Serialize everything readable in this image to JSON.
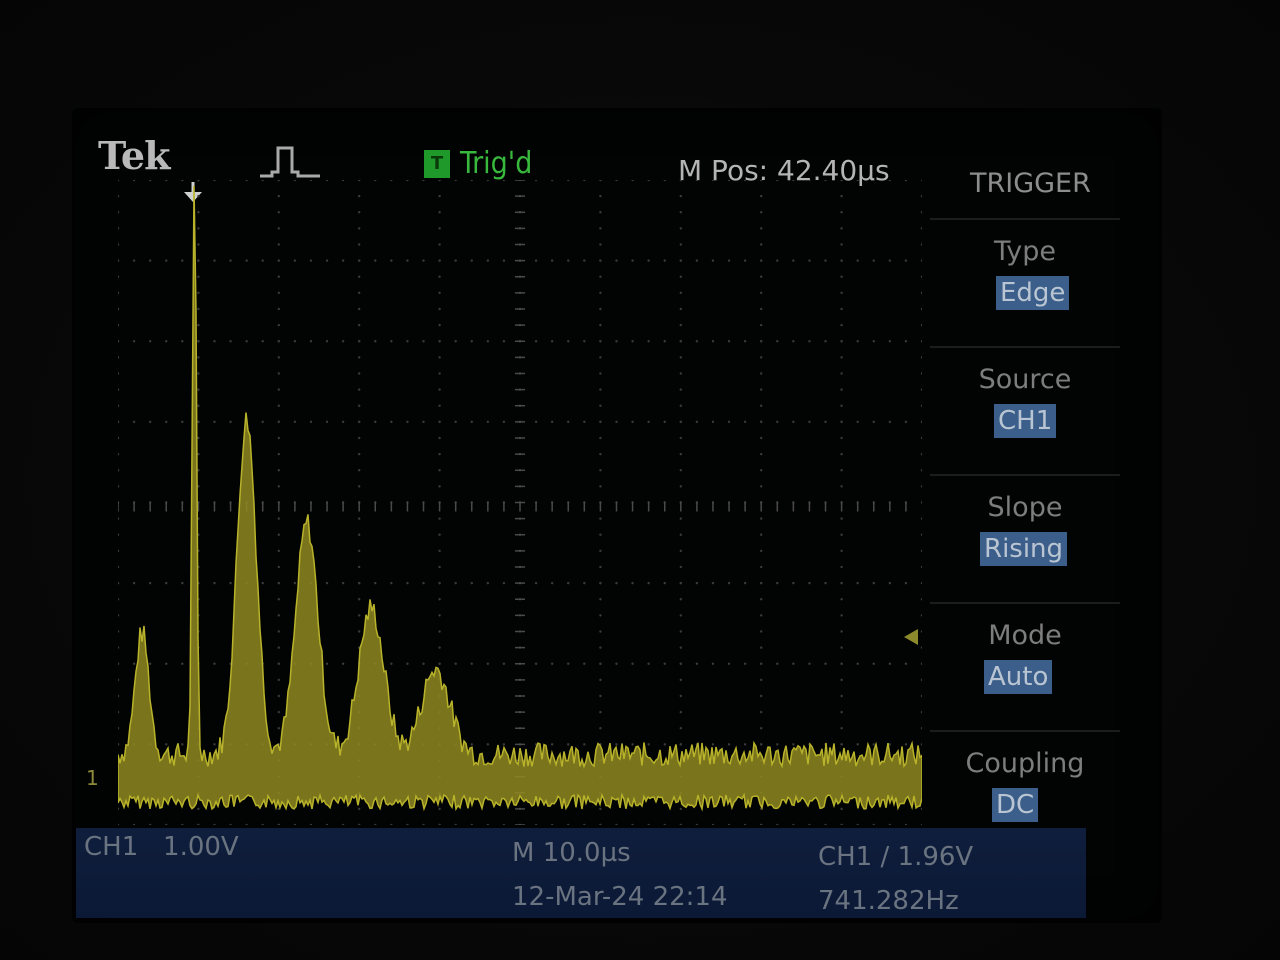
{
  "header": {
    "brand": "Tek",
    "acquisition_icon": "pulse-waveform-icon",
    "trigger_status_badge": "T",
    "trigger_status": "Trig'd",
    "horizontal_position": "M Pos: 42.40µs"
  },
  "trigger_menu": {
    "title": "TRIGGER",
    "items": [
      {
        "label": "Type",
        "value": "Edge"
      },
      {
        "label": "Source",
        "value": "CH1"
      },
      {
        "label": "Slope",
        "value": "Rising"
      },
      {
        "label": "Mode",
        "value": "Auto"
      },
      {
        "label": "Coupling",
        "value": "DC"
      }
    ]
  },
  "status_bar": {
    "ch1_scale": "CH1   1.00V",
    "timebase": "M 10.0µs",
    "datetime": "12-Mar-24 22:14",
    "trigger_level": "CH1 ∕ 1.96V",
    "frequency": "741.282Hz"
  },
  "ground_marker": "1",
  "colors": {
    "trace": "#b8b32a",
    "trigger_green": "#38b83c",
    "menu_highlight": "#3b5e8a",
    "status_bar": "#0f1e3c"
  },
  "waveform": {
    "description_peaks_us": [
      3.0,
      9.5,
      16.0,
      23.5,
      31.5,
      39.5
    ],
    "peak_relative_amplitude": [
      0.2,
      1.0,
      0.55,
      0.38,
      0.24,
      0.14
    ]
  }
}
